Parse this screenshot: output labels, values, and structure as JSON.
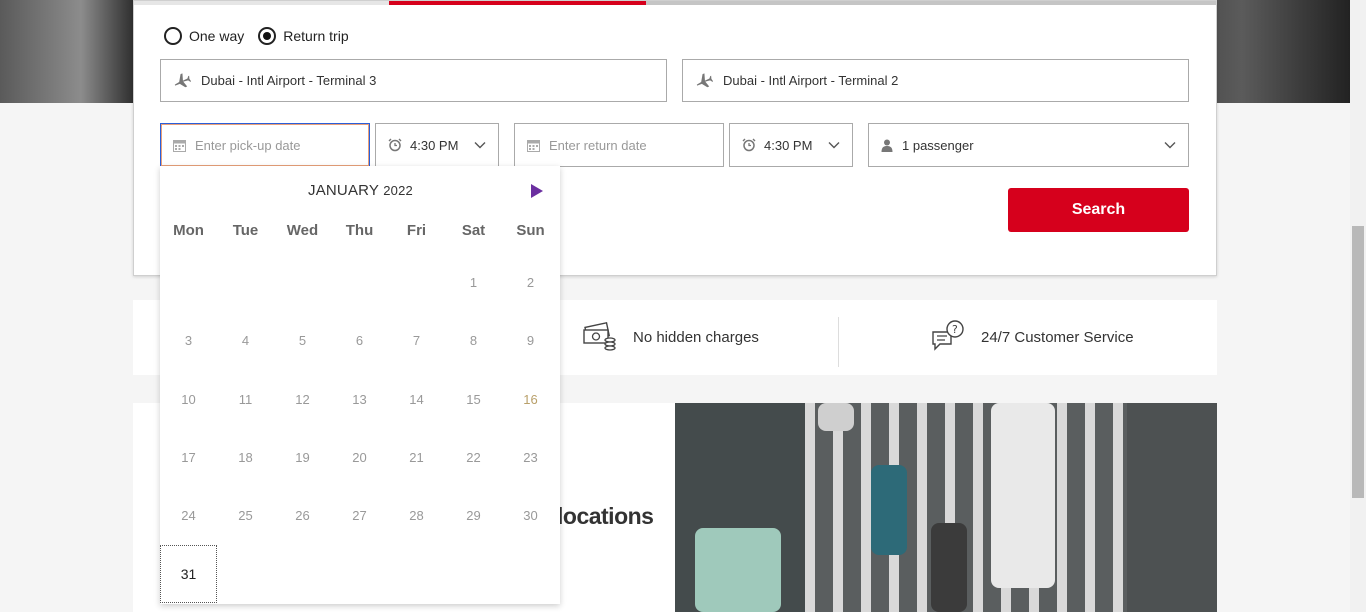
{
  "trip_type": {
    "options": [
      {
        "label": "One way",
        "selected": false
      },
      {
        "label": "Return trip",
        "selected": true
      }
    ]
  },
  "pickup_location": {
    "value": "Dubai - Intl Airport - Terminal 3",
    "icon": "airplane-icon"
  },
  "dropoff_location": {
    "value": "Dubai - Intl Airport - Terminal 2",
    "icon": "airplane-icon"
  },
  "pickup_date": {
    "placeholder": "Enter pick-up date",
    "icon": "calendar-icon"
  },
  "pickup_time": {
    "value": "4:30 PM",
    "icon": "alarm-clock-icon"
  },
  "return_date": {
    "placeholder": "Enter return date",
    "icon": "calendar-icon"
  },
  "return_time": {
    "value": "4:30 PM",
    "icon": "alarm-clock-icon"
  },
  "passengers": {
    "value": "1 passenger",
    "icon": "person-icon"
  },
  "search_button": {
    "label": "Search"
  },
  "calendar": {
    "month": "JANUARY",
    "year": "2022",
    "weekdays": [
      "Mon",
      "Tue",
      "Wed",
      "Thu",
      "Fri",
      "Sat",
      "Sun"
    ],
    "weeks": [
      [
        "",
        "",
        "",
        "",
        "",
        "1",
        "2"
      ],
      [
        "3",
        "4",
        "5",
        "6",
        "7",
        "8",
        "9"
      ],
      [
        "10",
        "11",
        "12",
        "13",
        "14",
        "15",
        "16"
      ],
      [
        "17",
        "18",
        "19",
        "20",
        "21",
        "22",
        "23"
      ],
      [
        "24",
        "25",
        "26",
        "27",
        "28",
        "29",
        "30"
      ],
      [
        "31",
        "",
        "",
        "",
        "",
        "",
        ""
      ]
    ],
    "selected_day": "31",
    "highlighted_day": "16",
    "next_icon": "triangle-right-icon",
    "next_color": "#6b2fa0"
  },
  "features": [
    {
      "label": "No hidden charges",
      "icon": "money-stack-icon"
    },
    {
      "label": "24/7 Customer Service",
      "icon": "chat-question-icon"
    }
  ],
  "content": {
    "partial_heading": "locations"
  },
  "colors": {
    "accent": "#d6001c",
    "active_border": "#2b5fd9"
  }
}
